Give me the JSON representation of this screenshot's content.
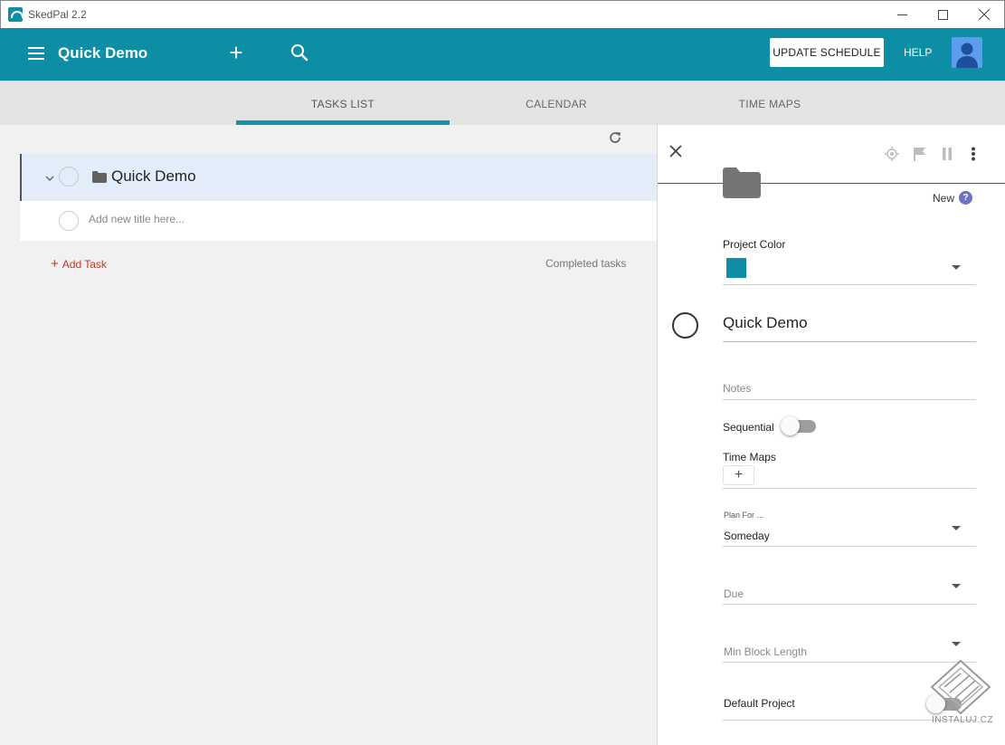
{
  "window": {
    "title": "SkedPal 2.2",
    "minimize_glyph": "—",
    "maximize_glyph": "☐",
    "close_glyph": "✕"
  },
  "header": {
    "title": "Quick Demo",
    "add_glyph": "+",
    "update_schedule_label": "UPDATE SCHEDULE",
    "help_label": "HELP"
  },
  "tabs": [
    {
      "label": "TASKS LIST",
      "active": true
    },
    {
      "label": "CALENDAR",
      "active": false
    },
    {
      "label": "TIME MAPS",
      "active": false
    }
  ],
  "task_list": {
    "project_name": "Quick Demo",
    "new_title_placeholder": "Add new title here...",
    "add_task_label": "Add Task",
    "add_task_glyph": "+",
    "completed_tasks_label": "Completed tasks"
  },
  "details": {
    "status_label": "New",
    "help_glyph": "?",
    "project_color_label": "Project Color",
    "project_color": "#0e8ea5",
    "project_title": "Quick Demo",
    "notes_placeholder": "Notes",
    "sequential_label": "Sequential",
    "sequential_on": false,
    "time_maps_label": "Time Maps",
    "time_maps_add_glyph": "+",
    "plan_for_label": "Plan For ...",
    "plan_for_value": "Someday",
    "due_placeholder": "Due",
    "min_block_placeholder": "Min Block Length",
    "default_project_label": "Default Project"
  },
  "watermark": {
    "text": "INSTALUJ.CZ"
  },
  "colors": {
    "accent": "#0e8ea5",
    "tab_indicator": "#1593ab",
    "selected_row": "#e3edf9",
    "add_task_red": "#c0392b",
    "help_badge": "#6e72c0"
  }
}
